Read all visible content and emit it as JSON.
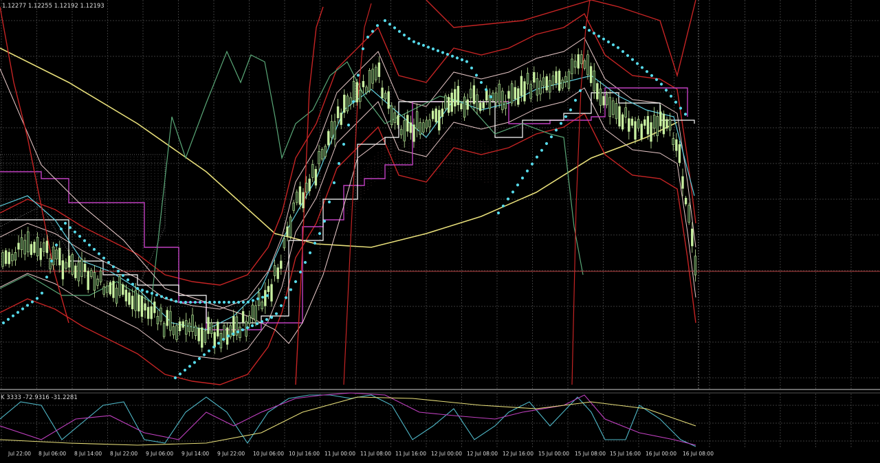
{
  "chart_data": {
    "type": "line",
    "main_panel": {
      "ohlc_text": "1.12277 1.12255 1.12192 1.12193",
      "grid": true,
      "colors": {
        "background": "#000000",
        "grid": "#3a3a3a",
        "candle": "#c8f0a0",
        "psar": "#55d8e8",
        "ma_slow": "#e8df7a",
        "bollinger": "#c62424",
        "envelope": "#e8c8c8",
        "ichimoku_kijun": "#c040c0",
        "ichimoku_tenkan": "#ffffff",
        "cloud": "#cfcfcf",
        "oscillator_line": "#5aa878",
        "horizontal_level": "#b84040"
      }
    },
    "sub_panel": {
      "header_text": "K 3333 -72.9316 -31.2281",
      "colors": {
        "stoch_main": "#4fb8c8",
        "stoch_signal": "#c040c0",
        "smooth": "#e8df7a",
        "grid": "#3a3a3a"
      }
    },
    "x_labels": [
      "Jul 22:00",
      "8 Jul 06:00",
      "8 Jul 14:00",
      "8 Jul 22:00",
      "9 Jul 06:00",
      "9 Jul 14:00",
      "9 Jul 22:00",
      "10 Jul 06:00",
      "10 Jul 16:00",
      "11 Jul 00:00",
      "11 Jul 08:00",
      "11 Jul 16:00",
      "12 Jul 00:00",
      "12 Jul 08:00",
      "12 Jul 16:00",
      "15 Jul 00:00",
      "15 Jul 08:00",
      "15 Jul 16:00",
      "16 Jul 00:00",
      "16 Jul 08:00"
    ]
  }
}
